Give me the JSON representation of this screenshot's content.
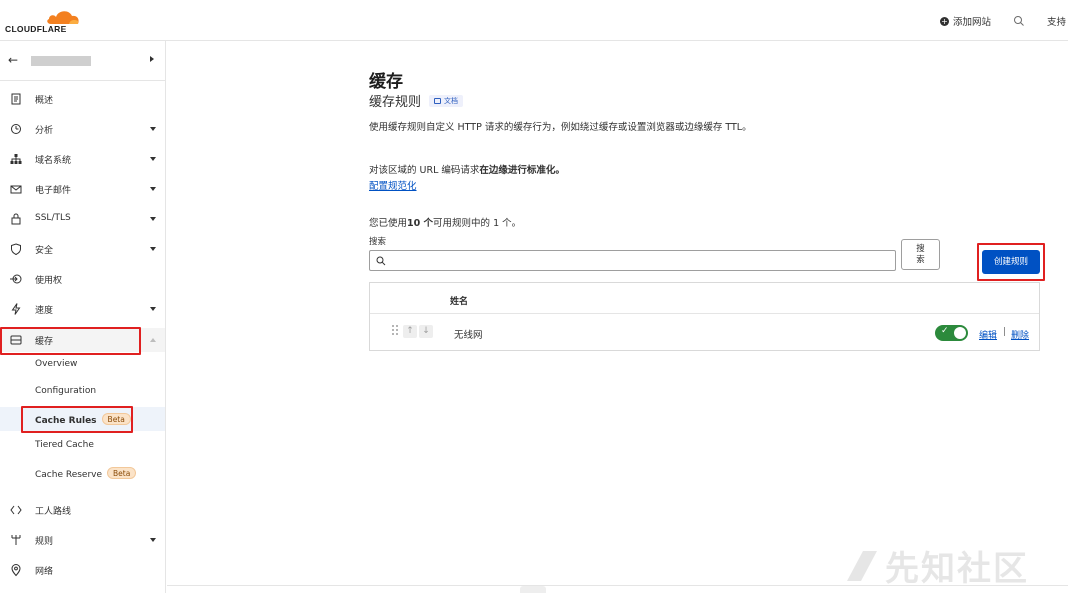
{
  "header": {
    "logo_text": "CLOUDFLARE",
    "add_site": "添加网站",
    "support": "支持"
  },
  "sidebar": {
    "items": [
      {
        "label": "概述",
        "icon": "document-icon"
      },
      {
        "label": "分析",
        "icon": "clock-icon"
      },
      {
        "label": "域名系统",
        "icon": "network-icon"
      },
      {
        "label": "电子邮件",
        "icon": "email-icon"
      },
      {
        "label": "SSL/TLS",
        "icon": "lock-icon"
      },
      {
        "label": "安全",
        "icon": "shield-icon"
      },
      {
        "label": "使用权",
        "icon": "access-icon"
      },
      {
        "label": "速度",
        "icon": "lightning-icon"
      },
      {
        "label": "缓存",
        "icon": "storage-icon"
      }
    ],
    "cache_sub": [
      {
        "label": "Overview"
      },
      {
        "label": "Configuration"
      },
      {
        "label": "Cache Rules",
        "badge": "Beta"
      },
      {
        "label": "Tiered Cache"
      },
      {
        "label": "Cache Reserve",
        "badge": "Beta"
      }
    ],
    "bottom_items": [
      {
        "label": "工人路线",
        "icon": "workers-icon"
      },
      {
        "label": "规则",
        "icon": "rules-icon"
      },
      {
        "label": "网络",
        "icon": "location-icon"
      }
    ]
  },
  "main": {
    "title": "缓存",
    "subtitle": "缓存规则",
    "docs_badge": "文档",
    "description": "使用缓存规则自定义 HTTP 请求的缓存行为，例如绕过缓存或设置浏览器或边缘缓存 TTL。",
    "normalization_prefix": "对该区域的 URL 编码请求",
    "normalization_bold": "在边缘进行标准化。",
    "normalization_link": "配置规范化",
    "usage_prefix": "您已使用",
    "usage_bold": "10 个",
    "usage_suffix": "可用规则中的 1 个。",
    "search_label": "搜索",
    "search_placeholder": "",
    "search_button": "搜索",
    "create_button": "创建规则",
    "table": {
      "header_name": "姓名",
      "rows": [
        {
          "name": "无线网",
          "enabled": true,
          "edit": "编辑",
          "delete": "删除"
        }
      ]
    }
  },
  "watermark": "先知社区",
  "colors": {
    "brand_orange": "#f38020",
    "primary_blue": "#0051c3",
    "toggle_green": "#2c8a3c",
    "highlight_red": "#e02020"
  }
}
